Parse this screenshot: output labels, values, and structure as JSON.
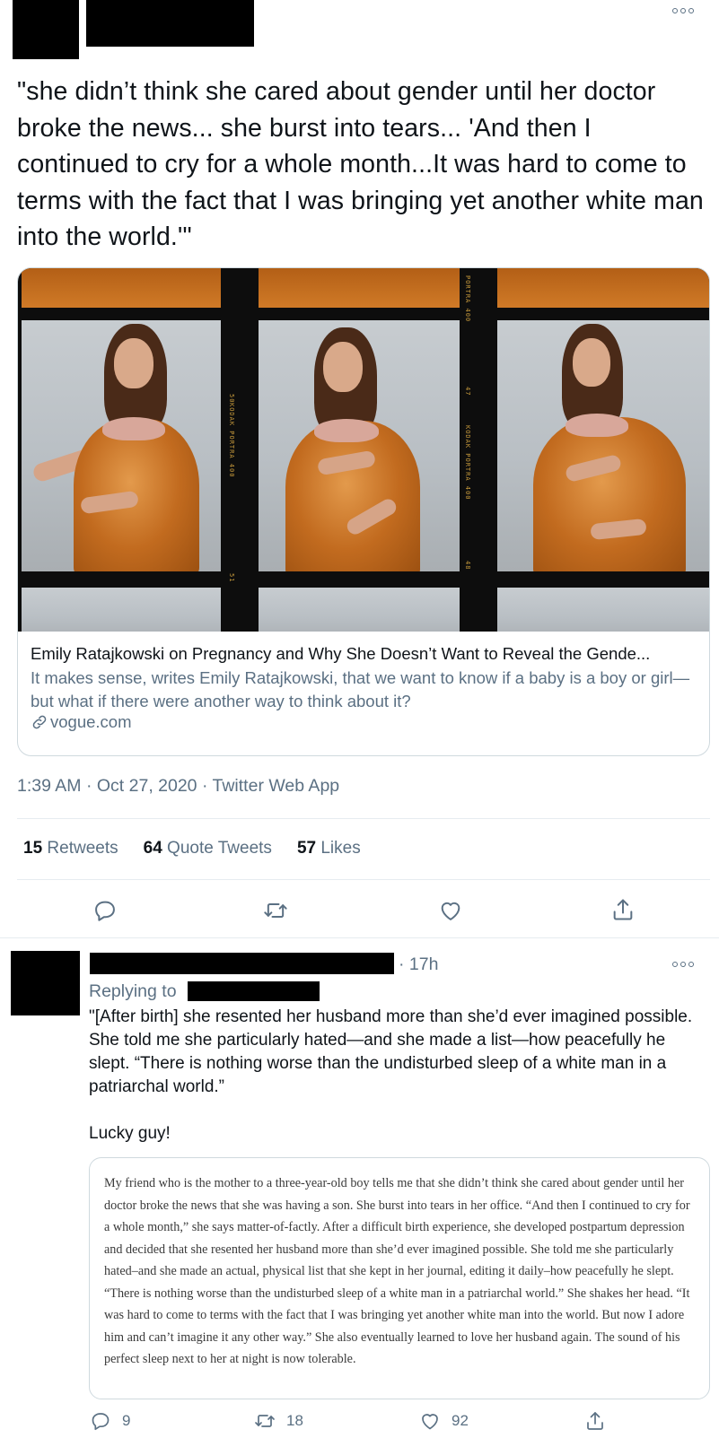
{
  "tweet": {
    "text": "\"she didn’t think she cared about gender until her doctor broke the news... she burst into tears... 'And then I continued to cry for a whole month...It was hard to come to terms with the fact that I was bringing yet another white man into the world.'\"",
    "card": {
      "title": "Emily Ratajkowski on Pregnancy and Why She Doesn’t Want to Reveal the Gende...",
      "description": "It makes sense, writes Emily Ratajkowski, that we want to know if a baby is a boy or girl—but what if there were another way to think about it?",
      "domain": "vogue.com",
      "film_labels": [
        "PORTRA 400",
        "KODAK PORTRA 400",
        "KODAK PORTRA 400",
        "47",
        "48",
        "50",
        "51"
      ]
    },
    "meta": "1:39 AM · Oct 27, 2020 · Twitter Web App",
    "stats": {
      "retweets_count": "15",
      "retweets_label": "Retweets",
      "quotes_count": "64",
      "quotes_label": "Quote Tweets",
      "likes_count": "57",
      "likes_label": "Likes"
    },
    "icons": [
      "reply-icon",
      "retweet-icon",
      "like-icon",
      "share-icon",
      "more-icon"
    ]
  },
  "reply": {
    "time": "· 17h",
    "replying_to": "Replying to",
    "text_p1": "\"[After birth] she resented her husband more than she’d ever imagined possible. She told me she particularly hated—and she made a list—how peacefully he slept. “There is nothing worse than the undisturbed sleep of a white man in a patriarchal world.”",
    "text_p2": "Lucky guy!",
    "quote": "My friend who is the mother to a three-year-old boy tells me that she didn’t think she cared about gender until her doctor broke the news that she was having a son. She burst into tears in her office. “And then I continued to cry for a whole month,” she says matter-of-factly. After a difficult birth experience, she developed postpartum depression and decided that she resented her husband more than she’d ever imagined possible. She told me she particularly hated–and she made an actual, physical list that she kept in her journal, editing it daily–how peacefully he slept. “There is nothing worse than the undisturbed sleep of a white man in a patriarchal world.” She shakes her head. “It was hard to come to terms with the fact that I was bringing yet another white man into the world. But now I adore him and can’t imagine it any other way.” She also eventually learned to love her husband again. The sound of his perfect sleep next to her at night is now tolerable.",
    "actions": {
      "reply_count": "9",
      "retweet_count": "18",
      "like_count": "92"
    }
  },
  "colors": {
    "text": "#0f1419",
    "secondary": "#5b7083",
    "border": "#cfd9de",
    "divider": "#e6ecf0",
    "dress": "#c26b1f"
  }
}
